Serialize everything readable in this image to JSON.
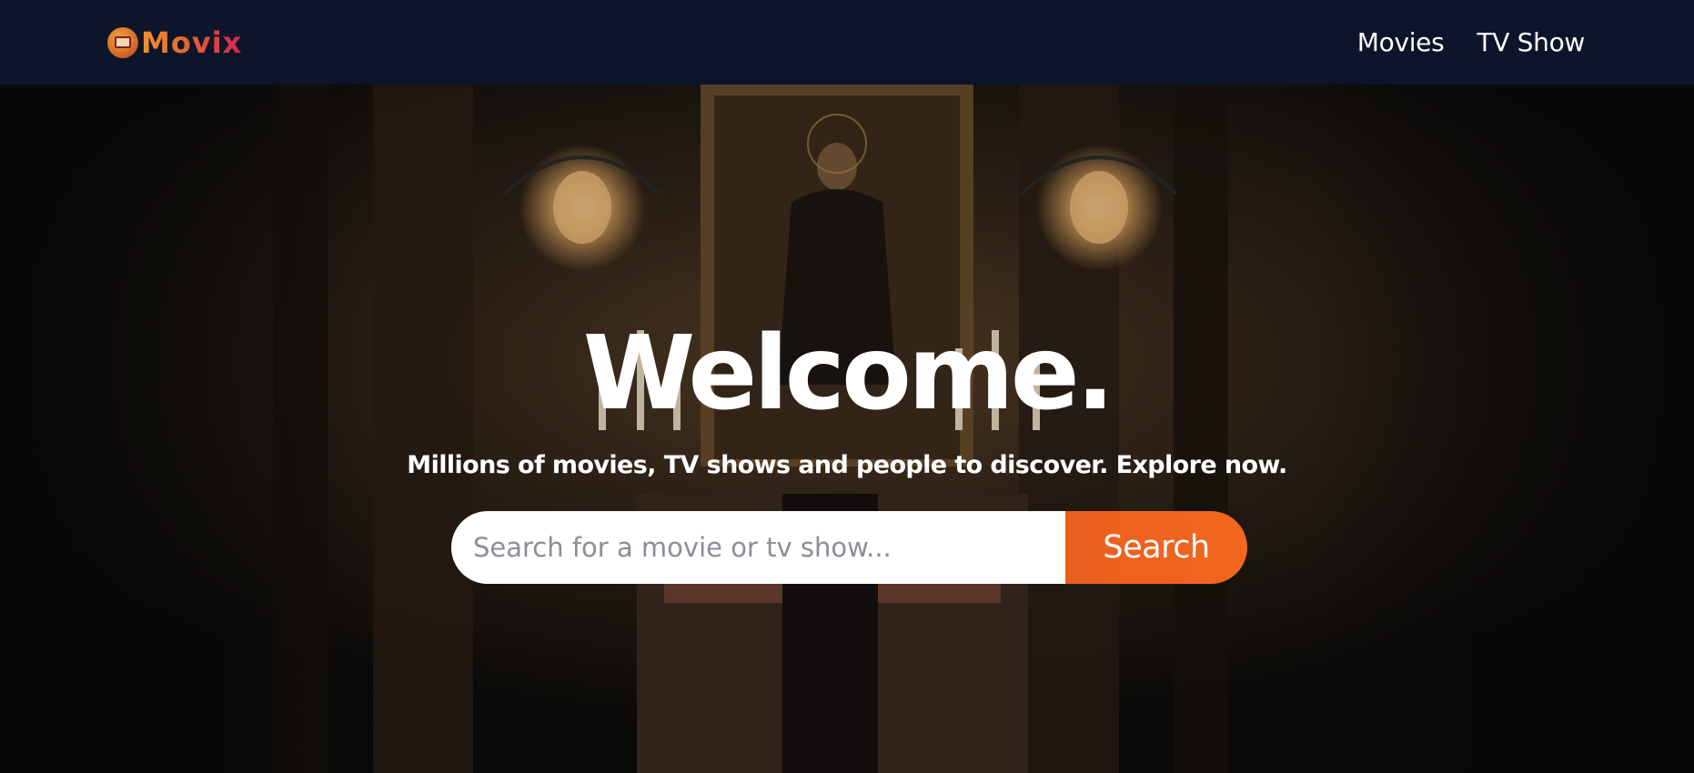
{
  "header": {
    "brand": "Movix",
    "nav": [
      {
        "label": "Movies"
      },
      {
        "label": "TV Show"
      }
    ]
  },
  "hero": {
    "title": "Welcome.",
    "subtitle": "Millions of movies, TV shows and people to discover. Explore now.",
    "search": {
      "placeholder": "Search for a movie or tv show...",
      "value": "",
      "button_label": "Search"
    }
  },
  "colors": {
    "header_bg": "#0d152a",
    "accent": "#ea5f1e",
    "logo_gradient_start": "#f0932b",
    "logo_gradient_end": "#d1274b"
  }
}
